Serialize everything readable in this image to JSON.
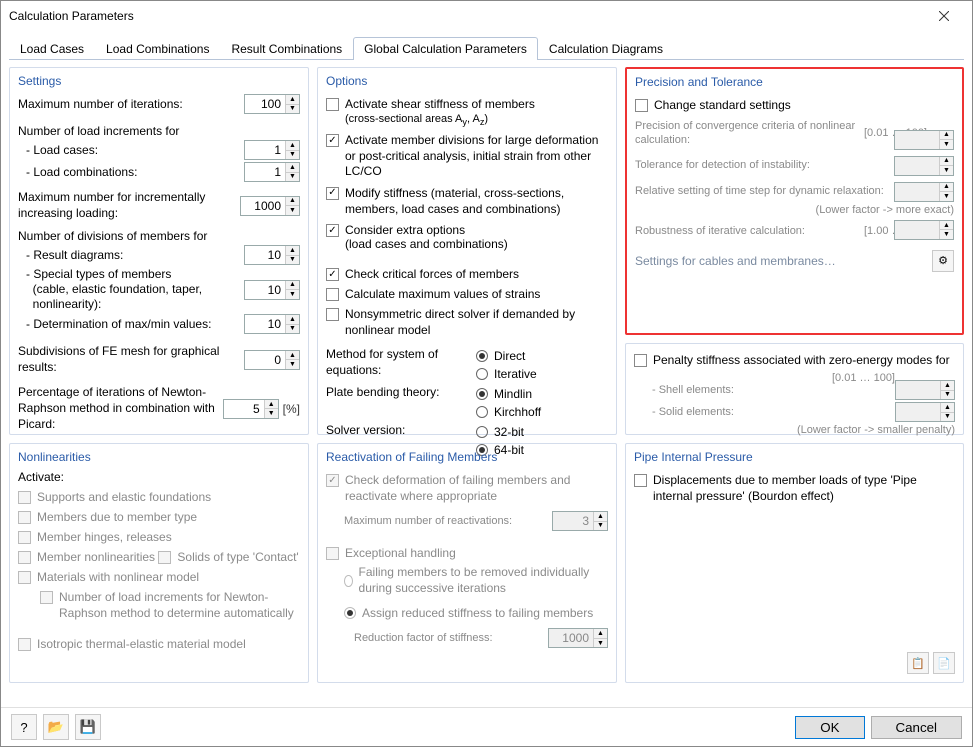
{
  "title": "Calculation Parameters",
  "tabs": [
    "Load Cases",
    "Load Combinations",
    "Result Combinations",
    "Global Calculation Parameters",
    "Calculation Diagrams"
  ],
  "active_tab": 3,
  "settings": {
    "title": "Settings",
    "max_iter": {
      "label": "Maximum number of iterations:",
      "value": 100
    },
    "load_incr_header": "Number of load increments for",
    "load_cases": {
      "label": "- Load cases:",
      "value": 1
    },
    "load_combos": {
      "label": "- Load combinations:",
      "value": 1
    },
    "inc_loading": {
      "label": "Maximum number for incrementally increasing loading:",
      "value": 1000
    },
    "divisions_header": "Number of divisions of members for",
    "result_diag": {
      "label": "- Result diagrams:",
      "value": 10
    },
    "special_types": {
      "label": "- Special types of members\n  (cable, elastic foundation, taper,\n  nonlinearity):",
      "value": 10
    },
    "maxmin": {
      "label": "- Determination of max/min values:",
      "value": 10
    },
    "fe_subdiv": {
      "label": "Subdivisions of FE mesh for graphical results:",
      "value": 0
    },
    "picard": {
      "label": "Percentage of iterations of Newton-Raphson method in combination with Picard:",
      "value": 5,
      "unit": "[%]"
    }
  },
  "options": {
    "title": "Options",
    "shear": {
      "label": "Activate shear stiffness of members",
      "sub": "(cross-sectional areas A",
      "sub2": "y",
      "sub3": ", A",
      "sub4": "z",
      "sub5": ")",
      "checked": false
    },
    "mdiv": {
      "label": "Activate member divisions for large deformation or post-critical analysis, initial strain from other LC/CO",
      "checked": true
    },
    "mod_stiff": {
      "label": "Modify stiffness (material, cross-sections, members, load cases and combinations)",
      "checked": true
    },
    "extra": {
      "label": "Consider extra options",
      "sub": "(load cases and combinations)",
      "checked": true
    },
    "critical": {
      "label": "Check critical forces of members",
      "checked": true
    },
    "strains": {
      "label": "Calculate maximum values of strains",
      "checked": false
    },
    "nonsym": {
      "label": "Nonsymmetric direct solver if demanded by nonlinear model",
      "checked": false
    },
    "method": {
      "label": "Method for system of equations:",
      "items": [
        "Direct",
        "Iterative"
      ],
      "selected": 0
    },
    "plate": {
      "label": "Plate bending theory:",
      "items": [
        "Mindlin",
        "Kirchhoff"
      ],
      "selected": 0
    },
    "solver": {
      "label": "Solver version:",
      "items": [
        "32-bit",
        "64-bit"
      ],
      "selected": 1
    }
  },
  "precision": {
    "title": "Precision and Tolerance",
    "change": {
      "label": "Change standard settings",
      "checked": false
    },
    "conv": {
      "label": "Precision of convergence criteria of nonlinear calculation:",
      "range": "[0.01 … 100]",
      "value": ""
    },
    "instability": {
      "label": "Tolerance for detection of instability:",
      "value": ""
    },
    "timestep": {
      "label": "Relative setting of time step for dynamic relaxation:",
      "value": "",
      "hint": "(Lower factor -> more exact)"
    },
    "robust": {
      "label": "Robustness of iterative calculation:",
      "range": "[1.00 … 100]",
      "value": ""
    },
    "cables_link": "Settings for cables and membranes…"
  },
  "penalty": {
    "label": "Penalty stiffness associated with zero-energy modes for",
    "range": "[0.01 … 100]",
    "shell": {
      "label": "- Shell elements:",
      "value": ""
    },
    "solid": {
      "label": "- Solid elements:",
      "value": ""
    },
    "hint": "(Lower factor -> smaller penalty)"
  },
  "nonlinearities": {
    "title": "Nonlinearities",
    "activate": "Activate:",
    "items": [
      "Supports and elastic foundations",
      "Members due to member type",
      "Member hinges, releases",
      "Member nonlinearities",
      "Solids of type 'Contact'",
      "Materials with nonlinear model"
    ],
    "nr_sub": "Number of load increments for Newton-Raphson method to determine automatically",
    "iso": "Isotropic thermal-elastic material model"
  },
  "reactivation": {
    "title": "Reactivation of Failing Members",
    "check_deform": "Check deformation of failing members and reactivate where appropriate",
    "max_react": {
      "label": "Maximum number of reactivations:",
      "value": 3
    },
    "exceptional": "Exceptional handling",
    "remove": "Failing members to be removed individually during successive iterations",
    "assign": "Assign reduced stiffness to failing members",
    "red_factor": {
      "label": "Reduction factor of stiffness:",
      "value": 1000
    }
  },
  "pipe": {
    "title": "Pipe Internal Pressure",
    "label": "Displacements due to member loads of type 'Pipe internal pressure' (Bourdon effect)"
  },
  "buttons": {
    "ok": "OK",
    "cancel": "Cancel"
  }
}
